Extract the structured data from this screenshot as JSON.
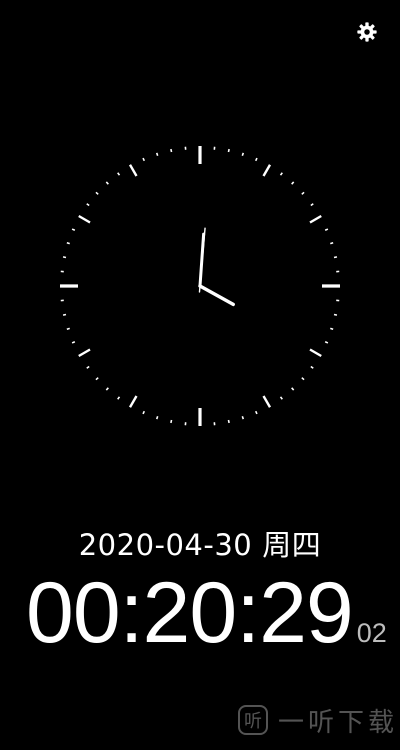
{
  "toolbar": {
    "settings_icon": "gear-icon"
  },
  "clock": {
    "type": "analog",
    "hour_hand_angle_deg": 119,
    "minute_hand_angle_deg": 4,
    "second_hand_angle_deg": 5,
    "tick_color": "#ffffff",
    "background": "#000000"
  },
  "date": {
    "text": "2020-04-30",
    "weekday": "周四"
  },
  "time": {
    "main": "00:20:29",
    "sub": "02"
  },
  "watermark": {
    "icon_glyph": "听",
    "text": "一听下载"
  }
}
